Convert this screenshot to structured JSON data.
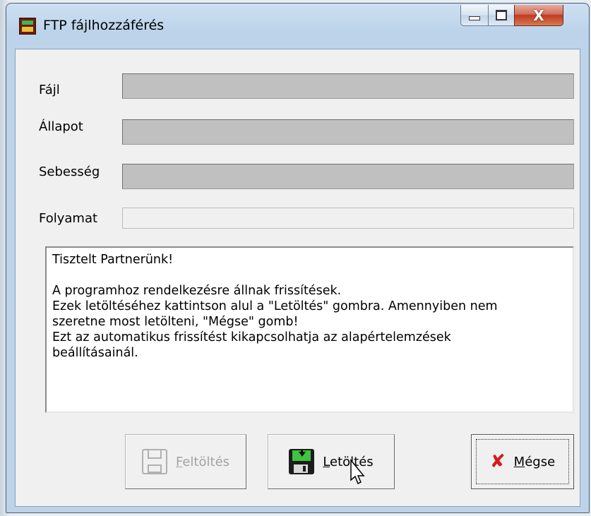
{
  "window": {
    "title": "FTP fájlhozzáférés",
    "app_icon": "ftp-app-icon",
    "buttons": {
      "minimize": "minimize-icon",
      "maximize": "maximize-icon",
      "close_glyph": "X"
    }
  },
  "form": {
    "file_label": "Fájl",
    "status_label": "Állapot",
    "speed_label": "Sebesség",
    "progress_label": "Folyamat",
    "file_value": "",
    "status_value": "",
    "speed_value": "",
    "progress_fraction": 0
  },
  "message": {
    "text": "Tisztelt Partnerünk!\n\nA programhoz rendelkezésre állnak frissítések.\nEzek letöltéséhez kattintson alul a \"Letöltés\" gombra. Amennyiben nem\nszeretne most letölteni, \"Mégse\" gomb!\nEzt az automatikus frissítést kikapcsolhatja az alapértelemzések\nbeállításainál."
  },
  "actions": {
    "upload": {
      "label_hotkey": "F",
      "label_rest": "eltöltés",
      "enabled": false,
      "icon": "floppy-disk-icon"
    },
    "download": {
      "label_hotkey": "L",
      "label_rest": "etöltés",
      "enabled": true,
      "icon": "download-disk-icon"
    },
    "cancel": {
      "label_hotkey": "M",
      "label_rest": "égse",
      "enabled": true,
      "icon": "x-icon"
    }
  },
  "colors": {
    "progress_fill": "#3ba83b",
    "cancel_icon": "#d31b1b",
    "field_background": "#c0c0c0"
  }
}
